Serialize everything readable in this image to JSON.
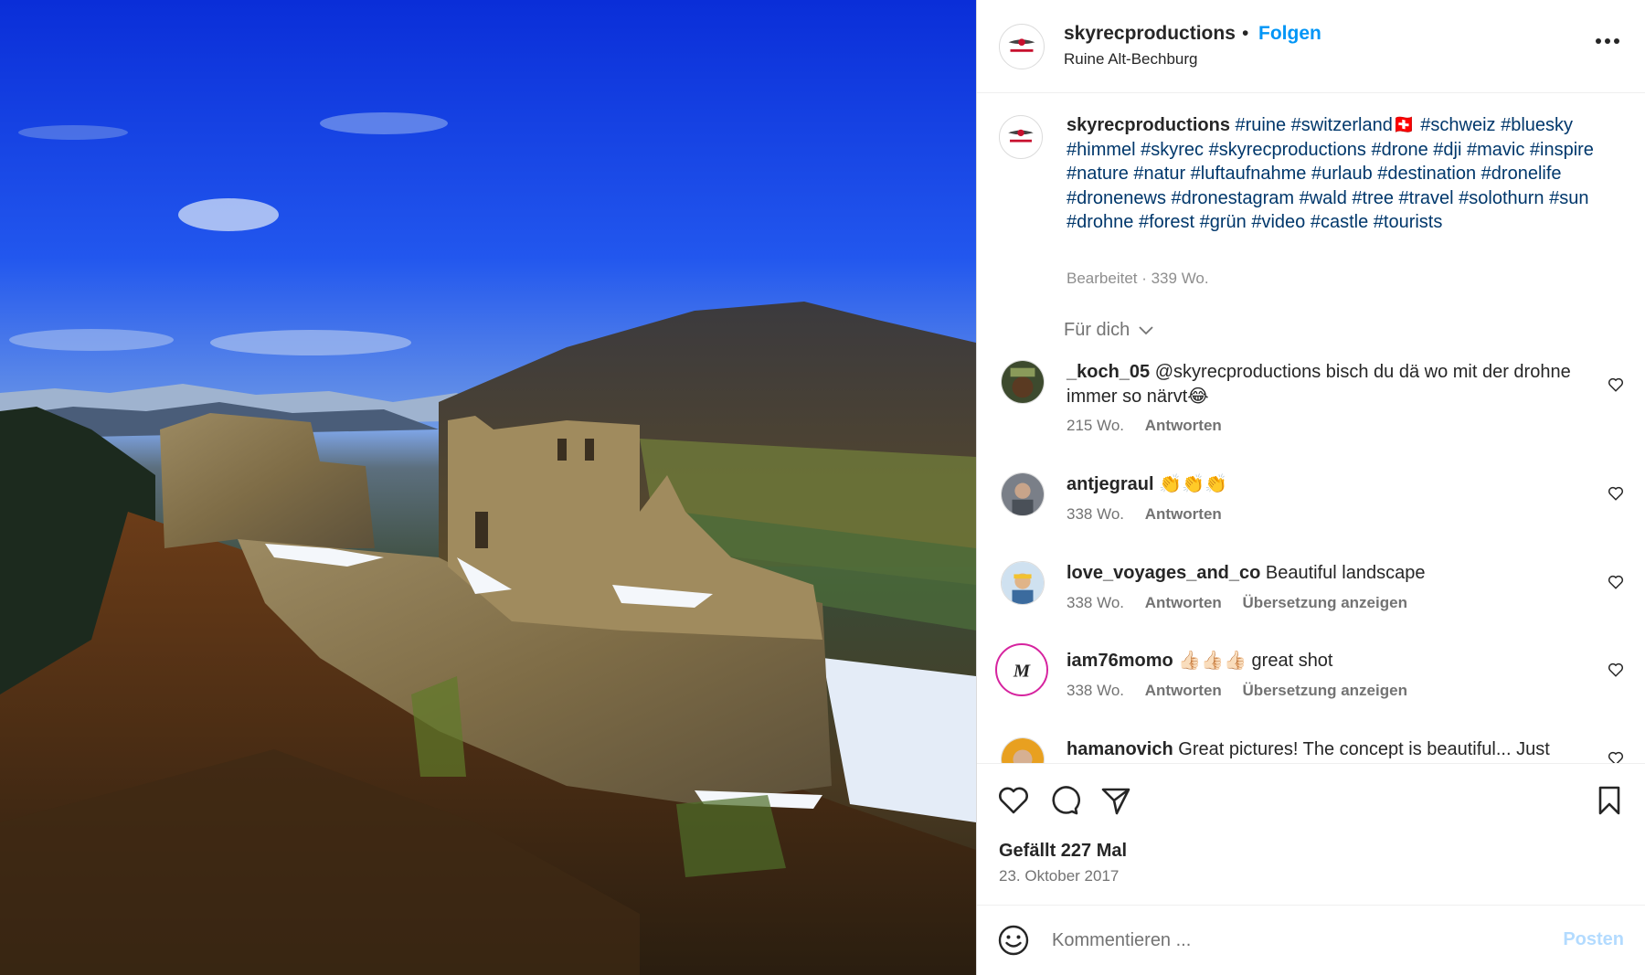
{
  "header": {
    "username": "skyrecproductions",
    "separator": "•",
    "follow_label": "Folgen",
    "location": "Ruine Alt-Bechburg"
  },
  "post": {
    "caption_user": "skyrecproductions",
    "caption_tags": "#ruine #switzerland🇨🇭 #schweiz #bluesky #himmel #skyrec #skyrecproductions #drone #dji #mavic #inspire #nature #natur #luftaufnahme #urlaub #destination #dronelife #dronenews #dronestagram #wald #tree #travel #solothurn #sun #drohne #forest #grün #video #castle #tourists",
    "caption_meta": "Bearbeitet · 339 Wo.",
    "for_you_label": "Für dich"
  },
  "comments": [
    {
      "user": "_koch_05",
      "text": "@skyrecproductions bisch du dä wo mit der drohne immer so närvt😂",
      "time": "215 Wo.",
      "reply": "Antworten",
      "translate": ""
    },
    {
      "user": "antjegraul",
      "text": "👏👏👏",
      "time": "338 Wo.",
      "reply": "Antworten",
      "translate": ""
    },
    {
      "user": "love_voyages_and_co",
      "text": "Beautiful landscape",
      "time": "338 Wo.",
      "reply": "Antworten",
      "translate": "Übersetzung anzeigen"
    },
    {
      "user": "iam76momo",
      "text": "👍🏻👍🏻👍🏻 great shot",
      "time": "338 Wo.",
      "reply": "Antworten",
      "translate": "Übersetzung anzeigen"
    },
    {
      "user": "hamanovich",
      "text": "Great pictures! The concept is beautiful... Just",
      "time": "",
      "reply": "",
      "translate": ""
    }
  ],
  "actions": {
    "likes": "Gefällt 227 Mal",
    "date": "23. Oktober 2017",
    "icons": [
      "heart-icon",
      "comment-icon",
      "share-icon",
      "bookmark-icon"
    ]
  },
  "compose": {
    "placeholder": "Kommentieren ...",
    "post_label": "Posten"
  },
  "colors": {
    "accent": "#0095f6",
    "hashtag": "#00376b",
    "muted": "#737373",
    "post_disabled": "#b3dbff"
  }
}
